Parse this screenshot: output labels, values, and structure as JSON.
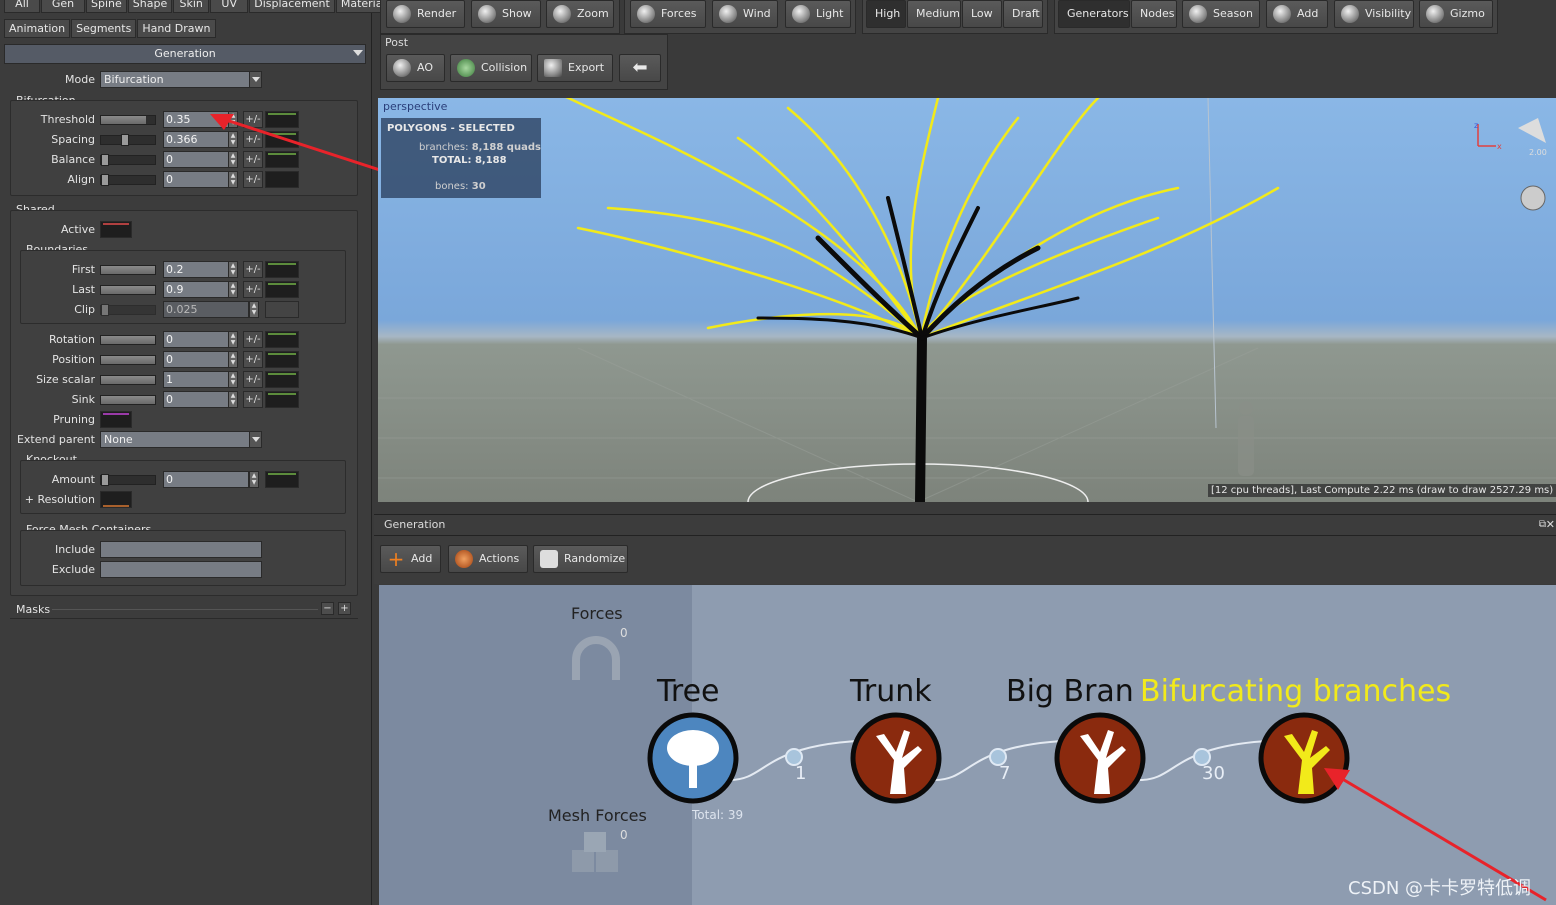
{
  "left_panel": {
    "tabs_row1": [
      "All",
      "Gen",
      "Spine",
      "Shape",
      "Skin",
      "UV",
      "Displacement",
      "Material"
    ],
    "tabs_row2": [
      "Animation",
      "Segments",
      "Hand Drawn"
    ],
    "header": "Generation",
    "mode_label": "Mode",
    "mode_value": "Bifurcation",
    "bifurcation_group": "Bifurcation",
    "threshold_label": "Threshold",
    "threshold_value": "0.35",
    "threshold_level": 0.35,
    "spacing_label": "Spacing",
    "spacing_value": "0.366",
    "spacing_level": 0.366,
    "balance_label": "Balance",
    "balance_value": "0",
    "align_label": "Align",
    "align_value": "0",
    "shared_group": "Shared",
    "active_label": "Active",
    "boundaries_group": "Boundaries",
    "first_label": "First",
    "first_value": "0.2",
    "last_label": "Last",
    "last_value": "0.9",
    "clip_label": "Clip",
    "clip_value": "0.025",
    "rotation_label": "Rotation",
    "rotation_value": "0",
    "position_label": "Position",
    "position_value": "0",
    "size_scalar_label": "Size scalar",
    "size_scalar_value": "1",
    "sink_label": "Sink",
    "sink_value": "0",
    "pruning_label": "Pruning",
    "extend_parent_label": "Extend parent",
    "extend_parent_value": "None",
    "knockout_group": "Knockout",
    "amount_label": "Amount",
    "amount_value": "0",
    "resolution_label": "+ Resolution",
    "force_mesh_group": "Force Mesh Containers",
    "include_label": "Include",
    "exclude_label": "Exclude",
    "masks_label": "Masks",
    "plusminus": "+/-",
    "minus": "−",
    "plus": "+"
  },
  "toolbar": {
    "render": "Render",
    "show": "Show",
    "zoom": "Zoom",
    "forces": "Forces",
    "wind": "Wind",
    "light": "Light",
    "high": "High",
    "medium": "Medium",
    "low": "Low",
    "draft": "Draft",
    "generators": "Generators",
    "nodes": "Nodes",
    "season": "Season",
    "add": "Add",
    "visibility": "Visibility",
    "gizmo": "Gizmo",
    "post_label": "Post",
    "ao": "AO",
    "collision": "Collision",
    "export": "Export"
  },
  "viewport": {
    "label": "perspective",
    "hud_title": "POLYGONS - SELECTED",
    "hud_branches_label": "branches:",
    "hud_branches_value": "8,188 quads",
    "hud_total_label": "TOTAL:",
    "hud_total_value": "8,188",
    "hud_bones_label": "bones:",
    "hud_bones_value": "30",
    "status": "[12 cpu threads], Last Compute 2.22 ms (draw to draw 2527.29 ms)",
    "gizmo_value": "2.00",
    "axis_z": "z",
    "axis_x": "x"
  },
  "generation": {
    "title": "Generation",
    "add": "Add",
    "actions": "Actions",
    "randomize": "Randomize",
    "forces_label": "Forces",
    "forces_count": "0",
    "mesh_forces_label": "Mesh Forces",
    "mesh_forces_count": "0",
    "total": "Total: 39",
    "nodes": [
      {
        "name": "Tree"
      },
      {
        "name": "Trunk",
        "count": "1"
      },
      {
        "name": "Big Bran",
        "count": "7"
      },
      {
        "name": "Bifurcating branches",
        "count": "30"
      }
    ]
  },
  "watermark": "CSDN @卡卡罗特低调"
}
